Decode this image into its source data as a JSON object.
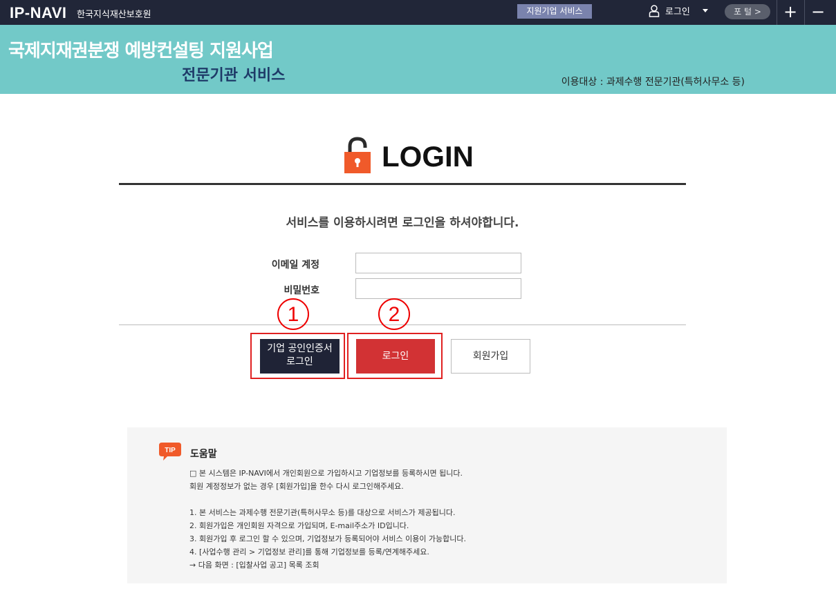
{
  "topbar": {
    "logo": "IP-NAVI",
    "org": "한국지식재산보호원",
    "service_btn": "지원기업 서비스",
    "login_label": "로그인",
    "portal_btn": "포 털 >",
    "plus": "+",
    "minus": "−"
  },
  "banner": {
    "title": "국제지재권분쟁 예방컨설팅 지원사업",
    "subtitle": "전문기관 서비스",
    "target": "이용대상 : 과제수행 전문기관(특허사무소 등)"
  },
  "login": {
    "heading": "LOGIN",
    "notice": "서비스를 이용하시려면 로그인을 하셔야합니다.",
    "email_label": "이메일 계정",
    "email_value": "",
    "password_label": "비밀번호",
    "password_value": "",
    "cert_btn_line1": "기업 공인인증서",
    "cert_btn_line2": "로그인",
    "login_btn": "로그인",
    "join_btn": "회원가입",
    "marker1": "1",
    "marker2": "2"
  },
  "help": {
    "badge": "TIP",
    "title": "도움말",
    "lines": [
      "□ 본 시스템은 IP-NAVI에서 개인회원으로 가입하시고 기업정보를 등록하시면 됩니다.",
      "회원 계정정보가 없는 경우 [회원가입]을 한수 다시 로그인해주세요.",
      "1. 본 서비스는 과제수행 전문기관(특허사무소 등)를 대상으로 서비스가 제공됩니다.",
      "2. 회원가입은 개인회원 자격으로 가입되며, E-mail주소가 ID입니다.",
      "3. 회원가입 후 로그인 할 수 있으며, 기업정보가 등록되어야 서비스 이용이 가능합니다.",
      "4. [사업수행 관리 > 기업정보 관리]를 통해 기업정보를 등록/연계해주세요.",
      "→ 다음 화면 : [입찰사업 공고] 목록 조회"
    ]
  },
  "colors": {
    "topbar": "#212638",
    "banner": "#72c9c8",
    "login_red": "#d23234",
    "cert_dark": "#1f2336",
    "lock_orange": "#f05a2a"
  }
}
